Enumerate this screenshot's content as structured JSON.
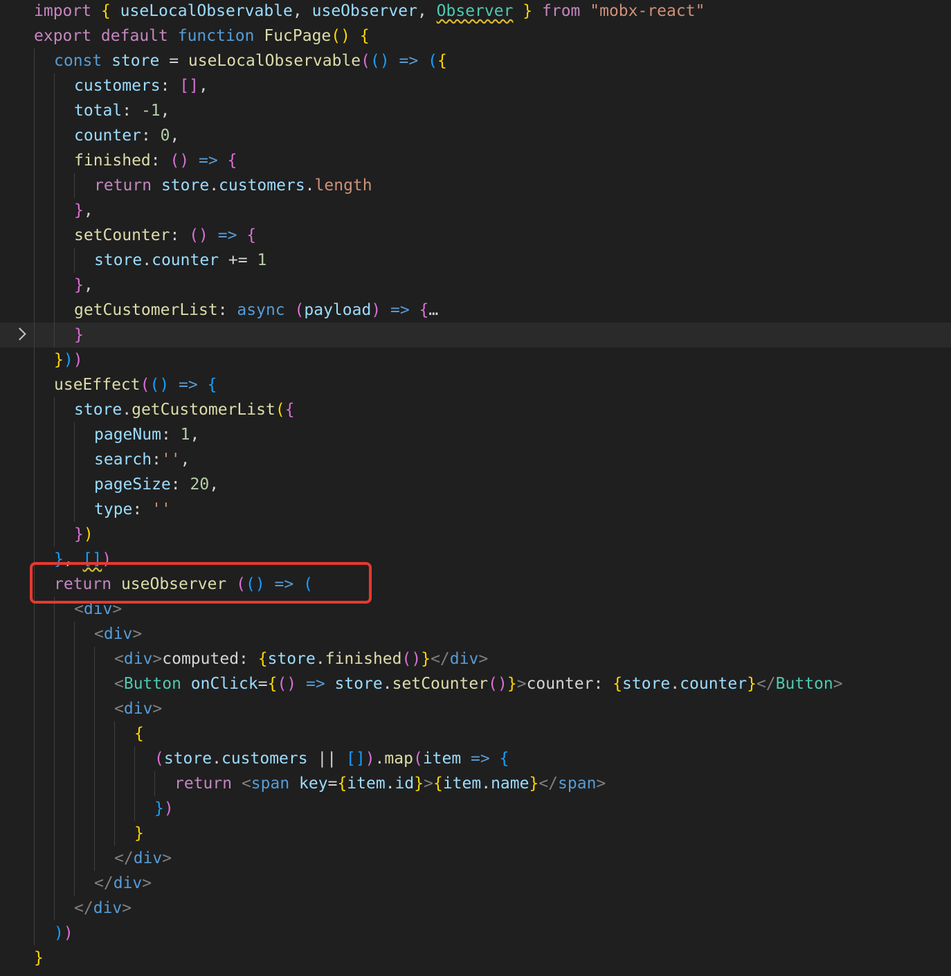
{
  "editor": {
    "language": "javascript",
    "highlighted_line": 13,
    "folded_line": 13,
    "annotation": {
      "color": "#e8382f",
      "target_line": 24
    },
    "colors": {
      "background": "#1f1f1f",
      "keyword": "#c586c0",
      "function": "#dcdcaa",
      "string": "#ce9178",
      "number": "#b5cea8",
      "bracket_level_1": "#ffd700",
      "bracket_level_2": "#da70d6",
      "bracket_level_3": "#179fff"
    },
    "lines": [
      {
        "indent": 0,
        "tokens": [
          {
            "t": "import",
            "c": "kw"
          },
          {
            "t": " ",
            "c": "pun"
          },
          {
            "t": "{",
            "c": "br1"
          },
          {
            "t": " useLocalObservable",
            "c": "var"
          },
          {
            "t": ", ",
            "c": "pun"
          },
          {
            "t": "useObserver",
            "c": "var"
          },
          {
            "t": ", ",
            "c": "pun"
          },
          {
            "t": "Observer",
            "c": "cls sq"
          },
          {
            "t": " ",
            "c": "pun"
          },
          {
            "t": "}",
            "c": "br1"
          },
          {
            "t": " from ",
            "c": "kw"
          },
          {
            "t": "\"mobx-react\"",
            "c": "str"
          }
        ]
      },
      {
        "indent": 0,
        "tokens": [
          {
            "t": "export default ",
            "c": "kw"
          },
          {
            "t": "function ",
            "c": "kb"
          },
          {
            "t": "FucPage",
            "c": "fn"
          },
          {
            "t": "()",
            "c": "br1"
          },
          {
            "t": " ",
            "c": "pun"
          },
          {
            "t": "{",
            "c": "br1"
          }
        ]
      },
      {
        "indent": 1,
        "tokens": [
          {
            "t": "const ",
            "c": "kb"
          },
          {
            "t": "store",
            "c": "var"
          },
          {
            "t": " = ",
            "c": "pun"
          },
          {
            "t": "useLocalObservable",
            "c": "fn"
          },
          {
            "t": "(",
            "c": "br2"
          },
          {
            "t": "()",
            "c": "br3"
          },
          {
            "t": " => ",
            "c": "kb"
          },
          {
            "t": "(",
            "c": "br3"
          },
          {
            "t": "{",
            "c": "br1"
          }
        ]
      },
      {
        "indent": 2,
        "tokens": [
          {
            "t": "customers",
            "c": "prop"
          },
          {
            "t": ": ",
            "c": "pun"
          },
          {
            "t": "[]",
            "c": "br2"
          },
          {
            "t": ",",
            "c": "pun"
          }
        ]
      },
      {
        "indent": 2,
        "tokens": [
          {
            "t": "total",
            "c": "prop"
          },
          {
            "t": ": ",
            "c": "pun"
          },
          {
            "t": "-1",
            "c": "num"
          },
          {
            "t": ",",
            "c": "pun"
          }
        ]
      },
      {
        "indent": 2,
        "tokens": [
          {
            "t": "counter",
            "c": "prop"
          },
          {
            "t": ": ",
            "c": "pun"
          },
          {
            "t": "0",
            "c": "num"
          },
          {
            "t": ",",
            "c": "pun"
          }
        ]
      },
      {
        "indent": 2,
        "tokens": [
          {
            "t": "finished",
            "c": "fn"
          },
          {
            "t": ": ",
            "c": "pun"
          },
          {
            "t": "()",
            "c": "br2"
          },
          {
            "t": " => ",
            "c": "kb"
          },
          {
            "t": "{",
            "c": "br2"
          }
        ]
      },
      {
        "indent": 3,
        "tokens": [
          {
            "t": "return ",
            "c": "kw"
          },
          {
            "t": "store",
            "c": "var"
          },
          {
            "t": ".",
            "c": "pun"
          },
          {
            "t": "customers",
            "c": "prop"
          },
          {
            "t": ".",
            "c": "pun"
          },
          {
            "t": "length",
            "c": "str"
          }
        ]
      },
      {
        "indent": 2,
        "tokens": [
          {
            "t": "}",
            "c": "br2"
          },
          {
            "t": ",",
            "c": "pun"
          }
        ]
      },
      {
        "indent": 2,
        "tokens": [
          {
            "t": "setCounter",
            "c": "fn"
          },
          {
            "t": ": ",
            "c": "pun"
          },
          {
            "t": "()",
            "c": "br2"
          },
          {
            "t": " => ",
            "c": "kb"
          },
          {
            "t": "{",
            "c": "br2"
          }
        ]
      },
      {
        "indent": 3,
        "tokens": [
          {
            "t": "store",
            "c": "var"
          },
          {
            "t": ".",
            "c": "pun"
          },
          {
            "t": "counter",
            "c": "prop"
          },
          {
            "t": " += ",
            "c": "pun"
          },
          {
            "t": "1",
            "c": "num"
          }
        ]
      },
      {
        "indent": 2,
        "tokens": [
          {
            "t": "}",
            "c": "br2"
          },
          {
            "t": ",",
            "c": "pun"
          }
        ]
      },
      {
        "indent": 2,
        "tokens": [
          {
            "t": "getCustomerList",
            "c": "fn"
          },
          {
            "t": ": ",
            "c": "pun"
          },
          {
            "t": "async ",
            "c": "kb"
          },
          {
            "t": "(",
            "c": "br2"
          },
          {
            "t": "payload",
            "c": "var"
          },
          {
            "t": ")",
            "c": "br2"
          },
          {
            "t": " => ",
            "c": "kb"
          },
          {
            "t": "{",
            "c": "br2"
          },
          {
            "t": "…",
            "c": "pun"
          }
        ]
      },
      {
        "indent": 2,
        "tokens": [
          {
            "t": "}",
            "c": "br2"
          }
        ]
      },
      {
        "indent": 1,
        "tokens": [
          {
            "t": "}",
            "c": "br1"
          },
          {
            "t": ")",
            "c": "br3"
          },
          {
            "t": ")",
            "c": "br2"
          }
        ]
      },
      {
        "indent": 1,
        "tokens": [
          {
            "t": "useEffect",
            "c": "fn"
          },
          {
            "t": "(",
            "c": "br2"
          },
          {
            "t": "()",
            "c": "br3"
          },
          {
            "t": " => ",
            "c": "kb"
          },
          {
            "t": "{",
            "c": "br3"
          }
        ]
      },
      {
        "indent": 2,
        "tokens": [
          {
            "t": "store",
            "c": "var"
          },
          {
            "t": ".",
            "c": "pun"
          },
          {
            "t": "getCustomerList",
            "c": "fn"
          },
          {
            "t": "(",
            "c": "br1"
          },
          {
            "t": "{",
            "c": "br2"
          }
        ]
      },
      {
        "indent": 3,
        "tokens": [
          {
            "t": "pageNum",
            "c": "prop"
          },
          {
            "t": ": ",
            "c": "pun"
          },
          {
            "t": "1",
            "c": "num"
          },
          {
            "t": ",",
            "c": "pun"
          }
        ]
      },
      {
        "indent": 3,
        "tokens": [
          {
            "t": "search",
            "c": "prop"
          },
          {
            "t": ":",
            "c": "pun"
          },
          {
            "t": "''",
            "c": "str"
          },
          {
            "t": ",",
            "c": "pun"
          }
        ]
      },
      {
        "indent": 3,
        "tokens": [
          {
            "t": "pageSize",
            "c": "prop"
          },
          {
            "t": ": ",
            "c": "pun"
          },
          {
            "t": "20",
            "c": "num"
          },
          {
            "t": ",",
            "c": "pun"
          }
        ]
      },
      {
        "indent": 3,
        "tokens": [
          {
            "t": "type",
            "c": "prop"
          },
          {
            "t": ": ",
            "c": "pun"
          },
          {
            "t": "''",
            "c": "str"
          }
        ]
      },
      {
        "indent": 2,
        "tokens": [
          {
            "t": "}",
            "c": "br2"
          },
          {
            "t": ")",
            "c": "br1"
          }
        ]
      },
      {
        "indent": 1,
        "tokens": [
          {
            "t": "}",
            "c": "br3"
          },
          {
            "t": ", ",
            "c": "pun"
          },
          {
            "t": "[]",
            "c": "br3 sq"
          },
          {
            "t": ")",
            "c": "br2"
          }
        ]
      },
      {
        "indent": 1,
        "tokens": [
          {
            "t": "return ",
            "c": "kw"
          },
          {
            "t": "useObserver",
            "c": "fn"
          },
          {
            "t": " ",
            "c": "pun"
          },
          {
            "t": "(",
            "c": "br2"
          },
          {
            "t": "()",
            "c": "br3"
          },
          {
            "t": " => ",
            "c": "kb"
          },
          {
            "t": "(",
            "c": "br3"
          }
        ]
      },
      {
        "indent": 2,
        "tokens": [
          {
            "t": "<",
            "c": "tagp"
          },
          {
            "t": "div",
            "c": "tag"
          },
          {
            "t": ">",
            "c": "tagp"
          }
        ]
      },
      {
        "indent": 3,
        "tokens": [
          {
            "t": "<",
            "c": "tagp"
          },
          {
            "t": "div",
            "c": "tag"
          },
          {
            "t": ">",
            "c": "tagp"
          }
        ]
      },
      {
        "indent": 4,
        "tokens": [
          {
            "t": "<",
            "c": "tagp"
          },
          {
            "t": "div",
            "c": "tag"
          },
          {
            "t": ">",
            "c": "tagp"
          },
          {
            "t": "computed: ",
            "c": "pun"
          },
          {
            "t": "{",
            "c": "br1"
          },
          {
            "t": "store",
            "c": "var"
          },
          {
            "t": ".",
            "c": "pun"
          },
          {
            "t": "finished",
            "c": "fn"
          },
          {
            "t": "()",
            "c": "br2"
          },
          {
            "t": "}",
            "c": "br1"
          },
          {
            "t": "</",
            "c": "tagp"
          },
          {
            "t": "div",
            "c": "tag"
          },
          {
            "t": ">",
            "c": "tagp"
          }
        ]
      },
      {
        "indent": 4,
        "tokens": [
          {
            "t": "<",
            "c": "tagp"
          },
          {
            "t": "Button",
            "c": "cls"
          },
          {
            "t": " onClick",
            "c": "attr"
          },
          {
            "t": "=",
            "c": "pun"
          },
          {
            "t": "{",
            "c": "br1"
          },
          {
            "t": "()",
            "c": "br2"
          },
          {
            "t": " => ",
            "c": "kb"
          },
          {
            "t": "store",
            "c": "var"
          },
          {
            "t": ".",
            "c": "pun"
          },
          {
            "t": "setCounter",
            "c": "fn"
          },
          {
            "t": "()",
            "c": "br2"
          },
          {
            "t": "}",
            "c": "br1"
          },
          {
            "t": ">",
            "c": "tagp"
          },
          {
            "t": "counter: ",
            "c": "pun"
          },
          {
            "t": "{",
            "c": "br1"
          },
          {
            "t": "store",
            "c": "var"
          },
          {
            "t": ".",
            "c": "pun"
          },
          {
            "t": "counter",
            "c": "prop"
          },
          {
            "t": "}",
            "c": "br1"
          },
          {
            "t": "</",
            "c": "tagp"
          },
          {
            "t": "Button",
            "c": "cls"
          },
          {
            "t": ">",
            "c": "tagp"
          }
        ]
      },
      {
        "indent": 4,
        "tokens": [
          {
            "t": "<",
            "c": "tagp"
          },
          {
            "t": "div",
            "c": "tag"
          },
          {
            "t": ">",
            "c": "tagp"
          }
        ]
      },
      {
        "indent": 5,
        "tokens": [
          {
            "t": "{",
            "c": "br1"
          }
        ]
      },
      {
        "indent": 6,
        "tokens": [
          {
            "t": "(",
            "c": "br2"
          },
          {
            "t": "store",
            "c": "var"
          },
          {
            "t": ".",
            "c": "pun"
          },
          {
            "t": "customers",
            "c": "prop"
          },
          {
            "t": " || ",
            "c": "pun"
          },
          {
            "t": "[]",
            "c": "br3"
          },
          {
            "t": ")",
            "c": "br2"
          },
          {
            "t": ".",
            "c": "pun"
          },
          {
            "t": "map",
            "c": "fn"
          },
          {
            "t": "(",
            "c": "br2"
          },
          {
            "t": "item",
            "c": "var"
          },
          {
            "t": " => ",
            "c": "kb"
          },
          {
            "t": "{",
            "c": "br3"
          }
        ]
      },
      {
        "indent": 7,
        "tokens": [
          {
            "t": "return ",
            "c": "kw"
          },
          {
            "t": "<",
            "c": "tagp"
          },
          {
            "t": "span",
            "c": "tag"
          },
          {
            "t": " key",
            "c": "attr"
          },
          {
            "t": "=",
            "c": "pun"
          },
          {
            "t": "{",
            "c": "br1"
          },
          {
            "t": "item",
            "c": "var"
          },
          {
            "t": ".",
            "c": "pun"
          },
          {
            "t": "id",
            "c": "prop"
          },
          {
            "t": "}",
            "c": "br1"
          },
          {
            "t": ">",
            "c": "tagp"
          },
          {
            "t": "{",
            "c": "br1"
          },
          {
            "t": "item",
            "c": "var"
          },
          {
            "t": ".",
            "c": "pun"
          },
          {
            "t": "name",
            "c": "prop"
          },
          {
            "t": "}",
            "c": "br1"
          },
          {
            "t": "</",
            "c": "tagp"
          },
          {
            "t": "span",
            "c": "tag"
          },
          {
            "t": ">",
            "c": "tagp"
          }
        ]
      },
      {
        "indent": 6,
        "tokens": [
          {
            "t": "}",
            "c": "br3"
          },
          {
            "t": ")",
            "c": "br2"
          }
        ]
      },
      {
        "indent": 5,
        "tokens": [
          {
            "t": "}",
            "c": "br1"
          }
        ]
      },
      {
        "indent": 4,
        "tokens": [
          {
            "t": "</",
            "c": "tagp"
          },
          {
            "t": "div",
            "c": "tag"
          },
          {
            "t": ">",
            "c": "tagp"
          }
        ]
      },
      {
        "indent": 3,
        "tokens": [
          {
            "t": "</",
            "c": "tagp"
          },
          {
            "t": "div",
            "c": "tag"
          },
          {
            "t": ">",
            "c": "tagp"
          }
        ]
      },
      {
        "indent": 2,
        "tokens": [
          {
            "t": "</",
            "c": "tagp"
          },
          {
            "t": "div",
            "c": "tag"
          },
          {
            "t": ">",
            "c": "tagp"
          }
        ]
      },
      {
        "indent": 1,
        "tokens": [
          {
            "t": ")",
            "c": "br3"
          },
          {
            "t": ")",
            "c": "br2"
          }
        ]
      },
      {
        "indent": 0,
        "tokens": [
          {
            "t": "}",
            "c": "br1"
          }
        ]
      }
    ]
  }
}
